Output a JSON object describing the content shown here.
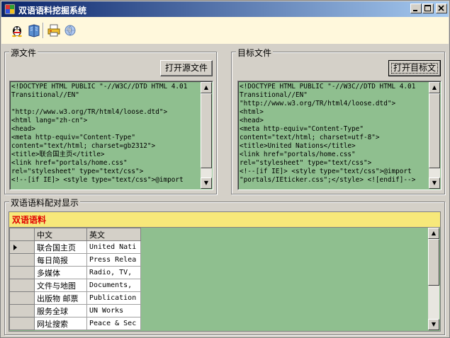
{
  "window": {
    "title": "双语语料挖掘系统",
    "controls": {
      "minimize": "0",
      "maximize": "1",
      "close": "r"
    }
  },
  "toolbar": {
    "icons": [
      "qq-penguin-icon",
      "book-icon",
      "print-icon",
      "globe-icon"
    ]
  },
  "source_group": {
    "title": "源文件",
    "open_button": "打开源文件",
    "content": "<!DOCTYPE HTML PUBLIC \"-//W3C//DTD HTML 4.01\nTransitional//EN\"\n\n\"http://www.w3.org/TR/html4/loose.dtd\">\n<html lang=\"zh-cn\">\n<head>\n<meta http-equiv=\"Content-Type\"\ncontent=\"text/html; charset=gb2312\">\n<title>联合国主页</title>\n<link href=\"portals/home.css\"\nrel=\"stylesheet\" type=\"text/css\">\n<!--[if IE]> <style type=\"text/css\">@import"
  },
  "target_group": {
    "title": "目标文件",
    "open_button": "打开目标文",
    "content": "<!DOCTYPE HTML PUBLIC \"-//W3C//DTD HTML 4.01\nTransitional//EN\"\n\"http://www.w3.org/TR/html4/loose.dtd\">\n<html>\n<head>\n<meta http-equiv=\"Content-Type\"\ncontent=\"text/html; charset=utf-8\">\n<title>United Nations</title>\n<link href=\"portals/home.css\"\nrel=\"stylesheet\" type=\"text/css\">\n<!--[if IE]> <style type=\"text/css\">@import\n\"portals/IEticker.css\";</style> <![endif]-->"
  },
  "pairs_group": {
    "title": "双语语料配对显示",
    "grid_caption": "双语语料",
    "columns": [
      "中文",
      "英文"
    ],
    "rows": [
      {
        "zh": "联合国主页",
        "en": "United Nati",
        "current": true
      },
      {
        "zh": "每日简报",
        "en": "Press Relea",
        "current": false
      },
      {
        "zh": "多媒体",
        "en": "Radio, TV,",
        "current": false
      },
      {
        "zh": "文件与地图",
        "en": "Documents,",
        "current": false
      },
      {
        "zh": "出版物 邮票",
        "en": "Publication",
        "current": false
      },
      {
        "zh": "服务全球",
        "en": "UN Works",
        "current": false
      },
      {
        "zh": "网址搜索",
        "en": "Peace & Sec",
        "current": false
      }
    ]
  },
  "colors": {
    "titlebar_start": "#0a246a",
    "titlebar_end": "#a6caf0",
    "toolbar_bg": "#fff8dc",
    "textbox_bg": "#8fbf8f",
    "grid_caption_bg": "#f7e87a",
    "grid_caption_text": "#e00000"
  }
}
